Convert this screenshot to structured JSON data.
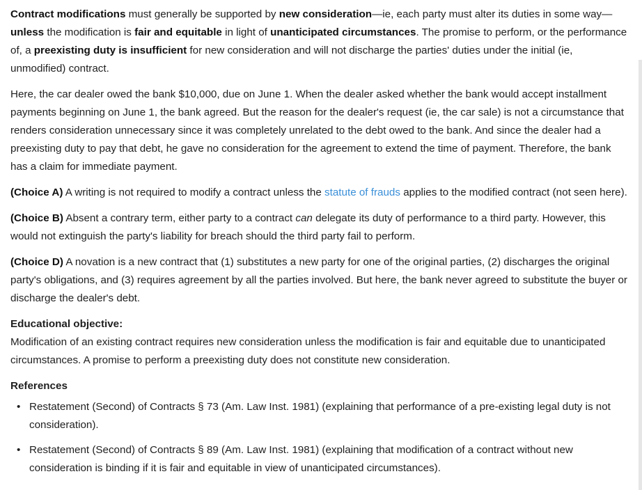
{
  "para1": {
    "t1": "Contract modifications",
    "t2": " must generally be supported by ",
    "t3": "new consideration",
    "t4": "—ie, each party must alter its duties in some way—",
    "t5": "unless",
    "t6": " the modification is ",
    "t7": "fair and equitable",
    "t8": " in light of ",
    "t9": "unanticipated circumstances",
    "t10": ".  The promise to perform, or the performance of, a ",
    "t11": "preexisting duty is insufficient",
    "t12": " for new consideration and will not discharge the parties' duties under the initial (ie, unmodified) contract."
  },
  "para2": "Here, the car dealer owed the bank $10,000, due on June 1.  When the dealer asked whether the bank would accept installment payments beginning on June 1, the bank agreed.  But the reason for the dealer's request (ie, the car sale) is not a circumstance that renders consideration unnecessary since it was completely unrelated to the debt owed to the bank.  And since the dealer had a preexisting duty to pay that debt, he gave no consideration for the agreement to extend the time of payment.  Therefore, the bank has a claim for immediate payment.",
  "choiceA": {
    "label": "(Choice A)",
    "t1": "  A writing is not required to modify a contract unless the ",
    "link": "statute of frauds",
    "t2": " applies to the modified contract (not seen here)."
  },
  "choiceB": {
    "label": "(Choice B)",
    "t1": "  Absent a contrary term, either party to a contract ",
    "em": "can",
    "t2": " delegate its duty of performance to a third party.  However, this would not extinguish the party's liability for breach should the third party fail to perform."
  },
  "choiceD": {
    "label": "(Choice D)",
    "t1": "  A novation is a new contract that (1) substitutes a new party for one of the original parties, (2) discharges the original party's obligations, and (3) requires agreement by all the parties involved.  But here, the bank never agreed to substitute the buyer or discharge the dealer's debt."
  },
  "objective": {
    "heading": "Educational objective:",
    "text": "Modification of an existing contract requires new consideration unless the modification is fair and equitable due to unanticipated circumstances.  A promise to perform a preexisting duty does not constitute new consideration."
  },
  "references": {
    "heading": "References",
    "bullet": "•",
    "items": [
      "Restatement (Second) of Contracts § 73 (Am. Law Inst. 1981) (explaining that performance of a pre-existing legal duty is not consideration).",
      "Restatement (Second) of Contracts § 89 (Am. Law Inst. 1981) (explaining that modification of a contract without new consideration is binding if it is fair and equitable in view of unanticipated circumstances)."
    ]
  }
}
